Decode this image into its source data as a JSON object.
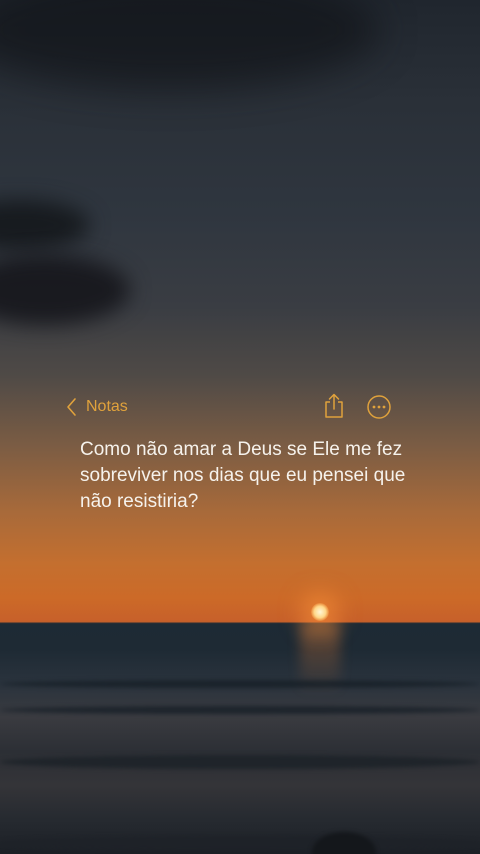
{
  "header": {
    "back_label": "Notas"
  },
  "note": {
    "text": "Como não amar a Deus se Ele me fez sobreviver nos dias que eu pensei que não resistiria?"
  },
  "icons": {
    "back": "chevron-left-icon",
    "share": "share-icon",
    "more": "ellipsis-circle-icon"
  },
  "colors": {
    "accent": "#e0a23c",
    "note_text": "#f6f2ec"
  }
}
